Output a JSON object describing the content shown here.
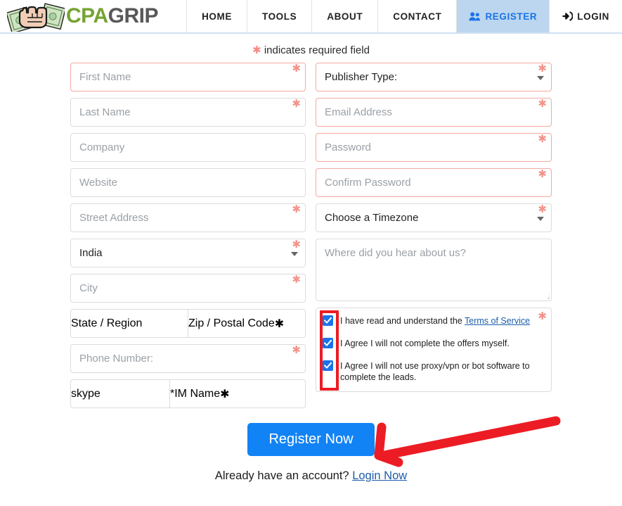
{
  "header": {
    "logo": {
      "part1": "CPA",
      "part2": "GRIP",
      "icon": "money-fist-logo"
    },
    "nav": [
      {
        "label": "HOME",
        "icon": null,
        "active": false
      },
      {
        "label": "TOOLS",
        "icon": null,
        "active": false
      },
      {
        "label": "ABOUT",
        "icon": null,
        "active": false
      },
      {
        "label": "CONTACT",
        "icon": null,
        "active": false
      },
      {
        "label": "REGISTER",
        "icon": "users-icon",
        "active": true
      },
      {
        "label": "LOGIN",
        "icon": "sign-in-icon",
        "active": false
      }
    ]
  },
  "required_note": "indicates required field",
  "asterisk": "✱",
  "form": {
    "left": {
      "first_name": {
        "placeholder": "First Name",
        "value": "",
        "required": true
      },
      "last_name": {
        "placeholder": "Last Name",
        "value": "",
        "required": true
      },
      "company": {
        "placeholder": "Company",
        "value": "",
        "required": false
      },
      "website": {
        "placeholder": "Website",
        "value": "",
        "required": false
      },
      "street_address": {
        "placeholder": "Street Address",
        "value": "",
        "required": true
      },
      "country": {
        "value": "India",
        "required": true
      },
      "city": {
        "placeholder": "City",
        "value": "",
        "required": true
      },
      "state": {
        "placeholder": "State / Region",
        "value": ""
      },
      "zip": {
        "placeholder": "Zip / Postal Code",
        "value": "",
        "required": true
      },
      "phone": {
        "placeholder": "Phone Number:",
        "value": "",
        "required": true
      },
      "im_type": {
        "value": "skype"
      },
      "im_name": {
        "placeholder": "*IM Name",
        "value": "",
        "required": true
      }
    },
    "right": {
      "publisher_type": {
        "value": "Publisher Type:",
        "required": true
      },
      "email": {
        "placeholder": "Email Address",
        "value": "",
        "required": true
      },
      "password": {
        "placeholder": "Password",
        "value": "",
        "required": true
      },
      "confirm_password": {
        "placeholder": "Confirm Password",
        "value": "",
        "required": true
      },
      "timezone": {
        "value": "Choose a Timezone",
        "required": true
      },
      "hear_about": {
        "placeholder": "Where did you hear about us?",
        "value": ""
      },
      "terms": {
        "required": true,
        "items": [
          {
            "text_before": "I have read and understand the ",
            "link": "Terms of Service",
            "text_after": "",
            "checked": true
          },
          {
            "text_before": "I Agree I will not complete the offers myself.",
            "link": "",
            "text_after": "",
            "checked": true
          },
          {
            "text_before": "I Agree I will not use proxy/vpn or bot software to complete the leads.",
            "link": "",
            "text_after": "",
            "checked": true
          }
        ]
      }
    }
  },
  "submit": {
    "label": "Register Now"
  },
  "footer": {
    "text": "Already have an account? ",
    "link": "Login Now"
  },
  "annotations": {
    "checkbox_highlight": {
      "shape": "rectangle",
      "color": "#ec1c24"
    },
    "arrow": {
      "shape": "arrow",
      "color": "#ec1c24",
      "points_to": "register-now-button"
    }
  },
  "colors": {
    "accent_blue": "#1283f5",
    "register_tab_bg": "#bcd6ef",
    "required_pink": "#f3938a",
    "logo_green": "#76a333",
    "logo_gray": "#58585a",
    "annotation_red": "#ec1c24"
  }
}
